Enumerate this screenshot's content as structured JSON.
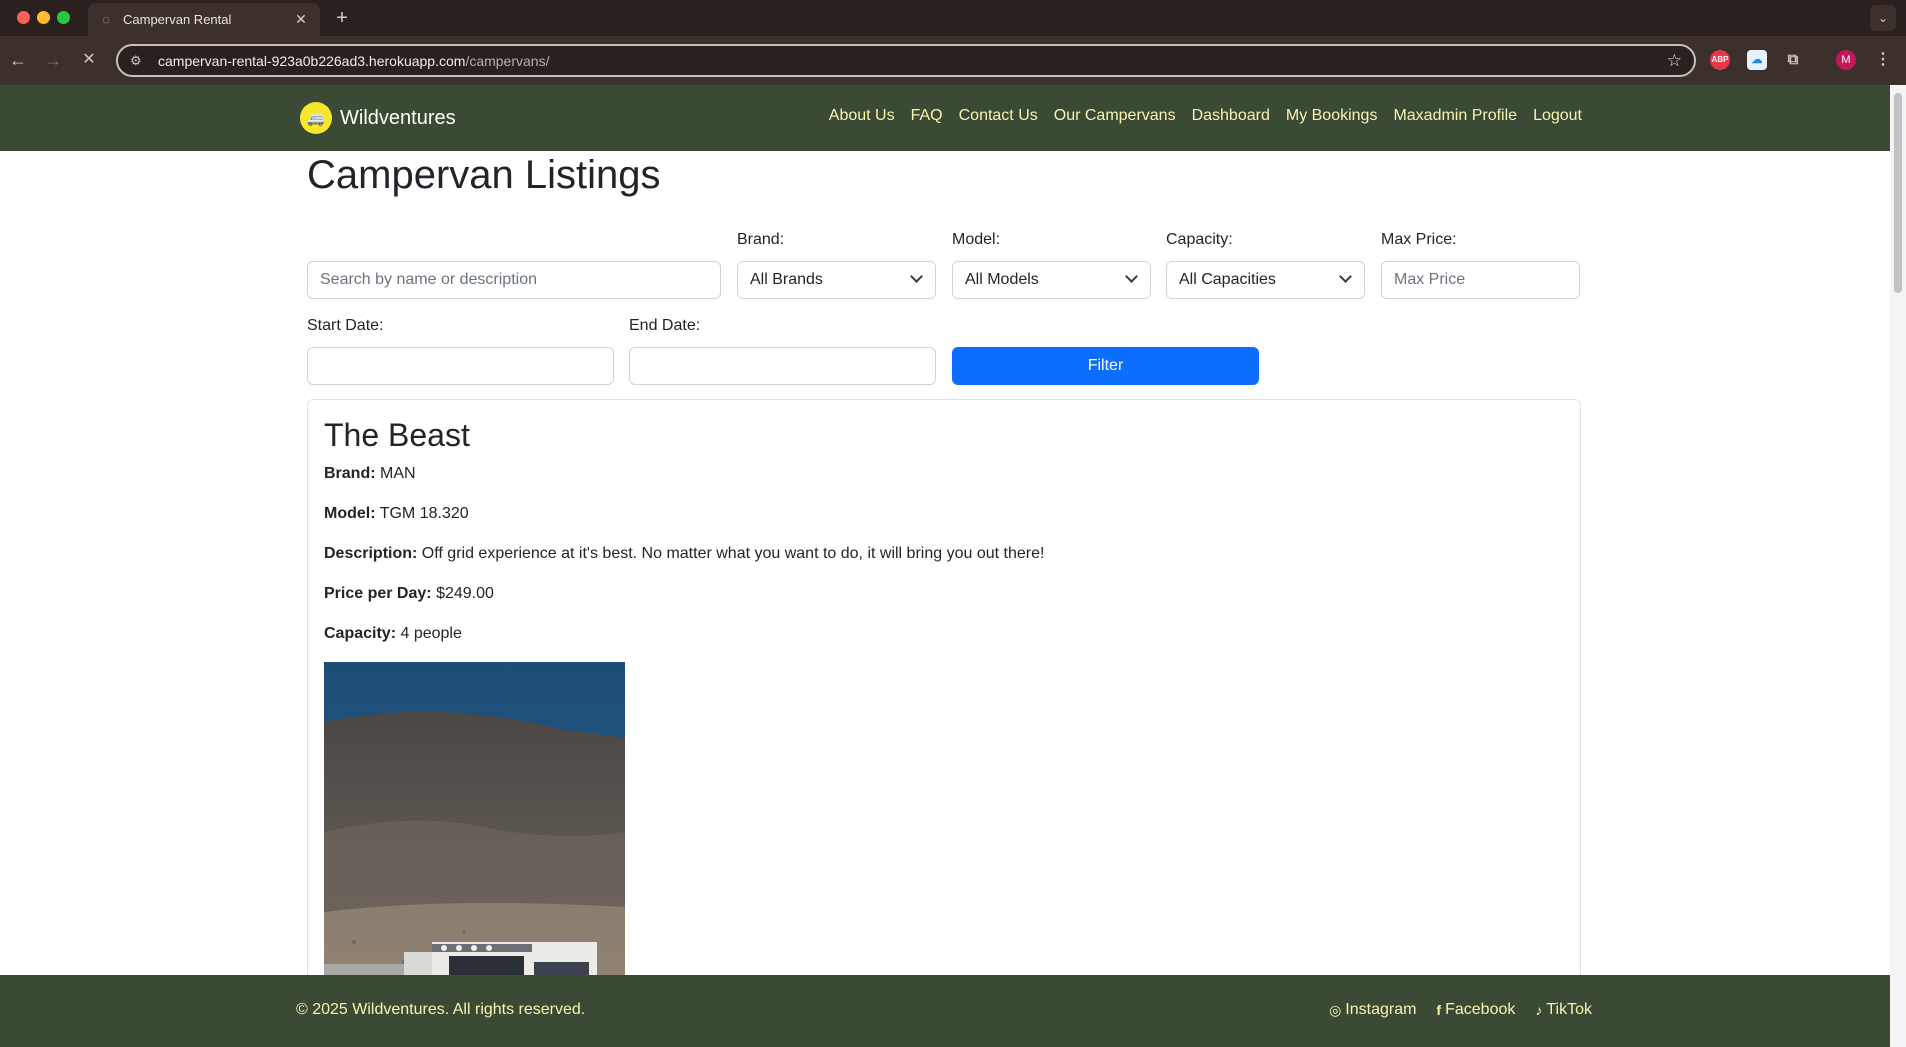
{
  "browser": {
    "tab_title": "Campervan Rental",
    "url_host": "campervan-rental-923a0b226ad3.herokuapp.com",
    "url_path": "/campervans/",
    "extensions": [
      "ABP",
      "cloud",
      "puzzle",
      "M"
    ]
  },
  "site": {
    "brand": "Wildventures",
    "nav": [
      "About Us",
      "FAQ",
      "Contact Us",
      "Our Campervans",
      "Dashboard",
      "My Bookings",
      "Maxadmin Profile",
      "Logout"
    ]
  },
  "page": {
    "title": "Campervan Listings"
  },
  "filters": {
    "search_placeholder": "Search by name or description",
    "brand_label": "Brand:",
    "brand_value": "All Brands",
    "model_label": "Model:",
    "model_value": "All Models",
    "capacity_label": "Capacity:",
    "capacity_value": "All Capacities",
    "max_price_label": "Max Price:",
    "max_price_placeholder": "Max Price",
    "start_date_label": "Start Date:",
    "end_date_label": "End Date:",
    "filter_button": "Filter"
  },
  "listing": {
    "name": "The Beast",
    "brand_label": "Brand:",
    "brand": "MAN",
    "model_label": "Model:",
    "model": "TGM 18.320",
    "description_label": "Description:",
    "description": "Off grid experience at it's best. No matter what you want to do, it will bring you out there!",
    "price_label": "Price per Day:",
    "price": "$249.00",
    "capacity_label": "Capacity:",
    "capacity": "4 people"
  },
  "footer": {
    "copyright": "© 2025 Wildventures. All rights reserved.",
    "instagram": "Instagram",
    "facebook": "Facebook",
    "tiktok": "TikTok"
  },
  "colors": {
    "nav_bg": "#3a4a34",
    "nav_link": "#fbf3b0",
    "primary": "#0d6efd"
  }
}
